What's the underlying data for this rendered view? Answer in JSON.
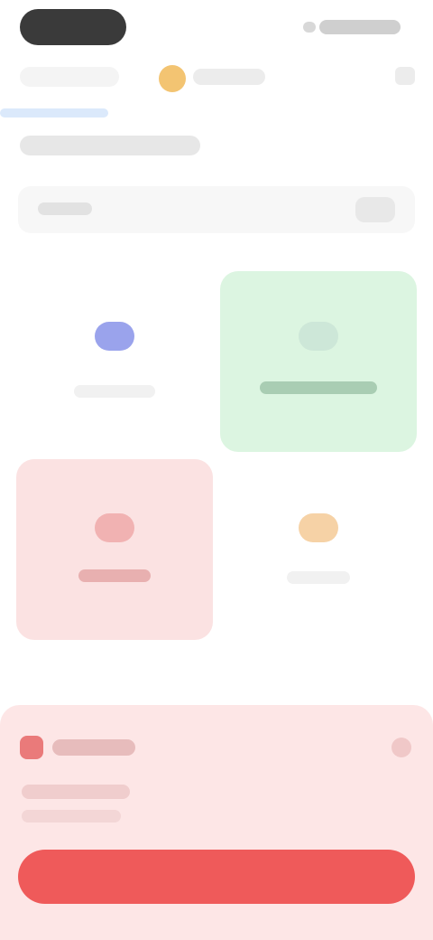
{
  "status_bar": {},
  "header": {
    "coin_balance": ""
  },
  "cards": [
    {
      "label": ""
    },
    {
      "label": ""
    },
    {
      "label": ""
    },
    {
      "label": ""
    }
  ],
  "bottom_panel": {
    "title": "",
    "button_label": ""
  },
  "colors": {
    "card_green": "#dcf5e1",
    "card_red": "#fbe2e2",
    "panel_bg": "#fde6e6",
    "button_red": "#ef5a5a"
  }
}
